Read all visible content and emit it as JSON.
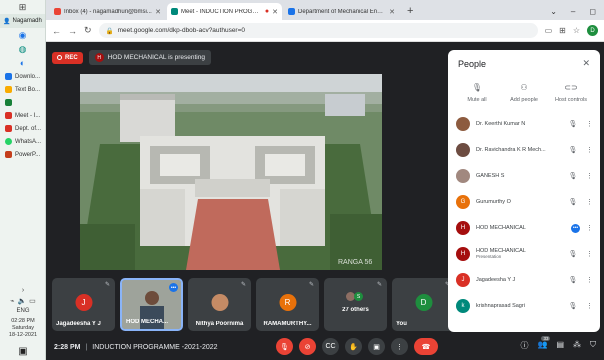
{
  "taskbar": {
    "user": "Nagamadh",
    "apps": [
      {
        "label": "Downlo...",
        "color": "#1a73e8"
      },
      {
        "label": "Text Bo...",
        "color": "#f9ab00"
      },
      {
        "label": "",
        "color": "#188038"
      },
      {
        "label": "Meet - I...",
        "color": "#d93025"
      },
      {
        "label": "Dept. of...",
        "color": "#d93025"
      },
      {
        "label": "WhatsA...",
        "color": "#25d366"
      },
      {
        "label": "PowerP...",
        "color": "#c43e1c"
      }
    ],
    "lang": "ENG",
    "clock": {
      "time": "02:28 PM",
      "day": "Saturday",
      "date": "18-12-2021"
    }
  },
  "browser": {
    "tabs": [
      {
        "title": "Inbox (4) - nagamadhuri@bmsi...",
        "active": false,
        "fav_color": "#ea4335"
      },
      {
        "title": "Meet - INDUCTION PROGRA...",
        "active": true,
        "fav_color": "#00897b"
      },
      {
        "title": "Department of Mechanical Engi...",
        "active": false,
        "fav_color": "#1a73e8"
      }
    ],
    "url": "meet.google.com/dkp-dbob-acv?authuser=0",
    "profile_initial": "D"
  },
  "meet": {
    "rec_label": "REC",
    "presenter_initial": "H",
    "presenting_text": "HOD MECHANICAL is presenting",
    "watermark": "RANGA 56",
    "tiles": [
      {
        "name": "Jagadeesha Y J",
        "initial": "J",
        "color": "#d93025",
        "type": "avatar"
      },
      {
        "name": "HOD MECHA...",
        "initial": "",
        "color": "#5f6368",
        "type": "video"
      },
      {
        "name": "Nithya Poornima",
        "initial": "",
        "color": "#c58b65",
        "type": "photo"
      },
      {
        "name": "RAMAMURTHY...",
        "initial": "R",
        "color": "#e8710a",
        "type": "avatar"
      },
      {
        "name": "27 others",
        "initial": "S",
        "color": "#1e8e3e",
        "type": "others"
      },
      {
        "name": "You",
        "initial": "D",
        "color": "#1e8e3e",
        "type": "avatar"
      }
    ],
    "time": "2:28 PM",
    "meeting_title": "INDUCTION PROGRAMME -2021-2022",
    "participant_count": "33"
  },
  "people": {
    "title": "People",
    "actions": {
      "mute_all": "Mute all",
      "add_people": "Add people",
      "host_controls": "Host controls"
    },
    "list": [
      {
        "name": "Dr. Keerthi Kumar N",
        "sub": "",
        "initial": "K",
        "color": "#8d5b3f",
        "mic": "muted"
      },
      {
        "name": "Dr. Ravichandra K R Mech...",
        "sub": "",
        "initial": "R",
        "color": "#6d4c41",
        "mic": "muted"
      },
      {
        "name": "GANESH S",
        "sub": "",
        "initial": "G",
        "color": "#a1887f",
        "mic": "muted"
      },
      {
        "name": "Gurumurthy O",
        "sub": "",
        "initial": "G",
        "color": "#e8710a",
        "mic": "muted"
      },
      {
        "name": "HOD MECHANICAL",
        "sub": "",
        "initial": "H",
        "color": "#a50e0e",
        "mic": "speaking"
      },
      {
        "name": "HOD MECHANICAL",
        "sub": "Presentation",
        "initial": "H",
        "color": "#a50e0e",
        "mic": "muted"
      },
      {
        "name": "Jagadeesha Y J",
        "sub": "",
        "initial": "J",
        "color": "#d93025",
        "mic": "muted"
      },
      {
        "name": "krishnaprasad Sagri",
        "sub": "",
        "initial": "k",
        "color": "#00897b",
        "mic": "muted"
      }
    ]
  }
}
